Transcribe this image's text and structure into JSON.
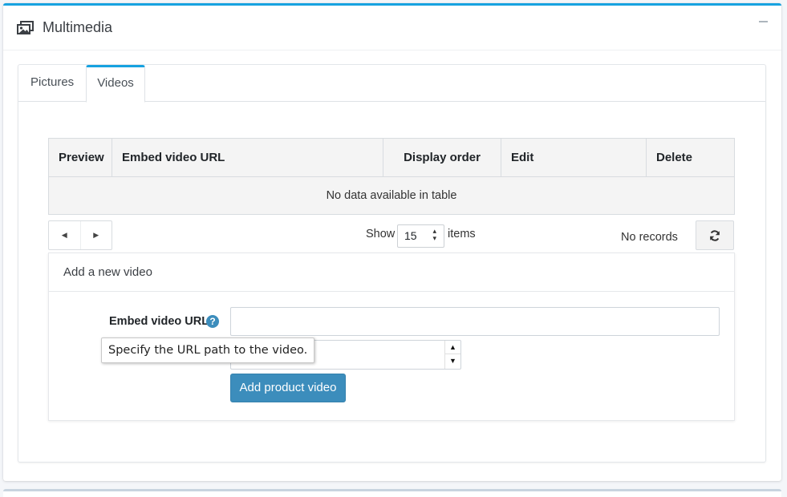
{
  "card": {
    "title": "Multimedia",
    "icon": "images-icon",
    "collapse_icon": "minus-icon"
  },
  "tabs": [
    {
      "label": "Pictures",
      "active": false
    },
    {
      "label": "Videos",
      "active": true
    }
  ],
  "grid": {
    "columns": [
      "Preview",
      "Embed video URL",
      "Display order",
      "Edit",
      "Delete"
    ],
    "empty_message": "No data available in table"
  },
  "pager": {
    "prev_icon": "caret-left-icon",
    "next_icon": "caret-right-icon",
    "show_label": "Show",
    "page_size": "15",
    "items_label": "items",
    "records_text": "No records",
    "refresh_icon": "refresh-icon"
  },
  "add_video": {
    "heading": "Add a new video",
    "embed_label": "Embed video URL",
    "help_icon": "question-circle-icon",
    "embed_value": "",
    "display_order_value": "",
    "tooltip": "Specify the URL path to the video.",
    "submit_label": "Add product video"
  },
  "colors": {
    "accent": "#17a2e0",
    "button": "#3c8dbc",
    "grid_bg": "#f4f4f4"
  }
}
